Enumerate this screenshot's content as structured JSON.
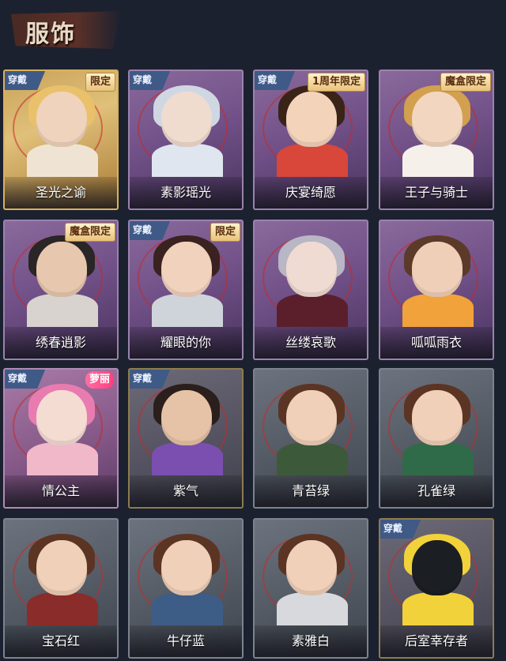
{
  "header": {
    "title": "服饰"
  },
  "badges": {
    "wear": "穿戴"
  },
  "items": [
    {
      "name": "圣光之谕",
      "wear": true,
      "tag": "限定",
      "tag_style": "limit",
      "theme": "gold",
      "hair": "#e8c16a",
      "skin": "#f0d3bd",
      "body": "#efe4d4"
    },
    {
      "name": "素影瑶光",
      "wear": true,
      "tag": "",
      "tag_style": "",
      "theme": "purple",
      "hair": "#cfd7e3",
      "skin": "#f0dbcf",
      "body": "#dfe6ef"
    },
    {
      "name": "庆宴绮愿",
      "wear": true,
      "tag": "1周年限定",
      "tag_style": "limit",
      "theme": "purple",
      "hair": "#3a2418",
      "skin": "#f3d4bb",
      "body": "#d9463a"
    },
    {
      "name": "王子与骑士",
      "wear": false,
      "tag": "魔盒限定",
      "tag_style": "limit",
      "theme": "purple",
      "hair": "#d2a04e",
      "skin": "#f2d6c0",
      "body": "#f5f0ea"
    },
    {
      "name": "绣春逍影",
      "wear": false,
      "tag": "魔盒限定",
      "tag_style": "limit",
      "theme": "purple",
      "hair": "#2a2526",
      "skin": "#e7c8ae",
      "body": "#d8d3cf"
    },
    {
      "name": "耀眼的你",
      "wear": true,
      "tag": "限定",
      "tag_style": "limit",
      "theme": "purple",
      "hair": "#3a2220",
      "skin": "#f0d2bd",
      "body": "#cfd4da"
    },
    {
      "name": "丝缕哀歌",
      "wear": false,
      "tag": "",
      "tag_style": "",
      "theme": "purple",
      "hair": "#b9b6c5",
      "skin": "#f0dbd2",
      "body": "#5b1f2c"
    },
    {
      "name": "呱呱雨衣",
      "wear": false,
      "tag": "",
      "tag_style": "",
      "theme": "purple",
      "hair": "#5c3a2a",
      "skin": "#f0cfb8",
      "body": "#f2a23a"
    },
    {
      "name": "情公主",
      "wear": true,
      "tag": "萝丽",
      "tag_style": "luoli",
      "theme": "pink",
      "hair": "#e87cb0",
      "skin": "#f5dcd3",
      "body": "#f0b8c8"
    },
    {
      "name": "紫气",
      "wear": true,
      "tag": "",
      "tag_style": "",
      "theme": "olive",
      "hair": "#2a1f1c",
      "skin": "#e6c3a6",
      "body": "#7b4fb0"
    },
    {
      "name": "青苔绿",
      "wear": false,
      "tag": "",
      "tag_style": "",
      "theme": "gray",
      "hair": "#5b3424",
      "skin": "#f0d0b8",
      "body": "#3c5a3a"
    },
    {
      "name": "孔雀绿",
      "wear": false,
      "tag": "",
      "tag_style": "",
      "theme": "gray",
      "hair": "#5b3424",
      "skin": "#f0d0b8",
      "body": "#2f6b48"
    },
    {
      "name": "宝石红",
      "wear": false,
      "tag": "",
      "tag_style": "",
      "theme": "gray",
      "hair": "#5b3424",
      "skin": "#f0d0b8",
      "body": "#8a2c2a"
    },
    {
      "name": "牛仔蓝",
      "wear": false,
      "tag": "",
      "tag_style": "",
      "theme": "gray",
      "hair": "#5b3424",
      "skin": "#f0d0b8",
      "body": "#3e5d86"
    },
    {
      "name": "素雅白",
      "wear": false,
      "tag": "",
      "tag_style": "",
      "theme": "gray",
      "hair": "#5b3424",
      "skin": "#f0d0b8",
      "body": "#d7d9dc"
    },
    {
      "name": "后室幸存者",
      "wear": true,
      "tag": "",
      "tag_style": "",
      "theme": "olive",
      "hair": "#f1d23a",
      "skin": "#1b1e22",
      "body": "#f1d23a"
    }
  ]
}
